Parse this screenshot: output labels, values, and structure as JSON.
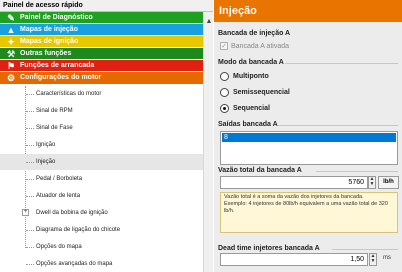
{
  "left_panel": {
    "title": "Painel de acesso rápido",
    "categories": [
      {
        "label": "Painel de Diagnóstico",
        "color": "#20a020",
        "icon": "wrench-icon"
      },
      {
        "label": "Mapas de injeção",
        "color": "#18a0e0",
        "icon": "injector-icon"
      },
      {
        "label": "Mapas de ignição",
        "color": "#e8c800",
        "icon": "spark-icon"
      },
      {
        "label": "Outras funções",
        "color": "#1e8a1e",
        "icon": "tool-icon"
      },
      {
        "label": "Funções de arrancada",
        "color": "#e02010",
        "icon": "flag-icon"
      },
      {
        "label": "Configurações do motor",
        "color": "#e46a00",
        "icon": "engine-icon"
      }
    ],
    "sub_items": [
      "Características do motor",
      "Sinal de RPM",
      "Sinal de Fase",
      "Ignição",
      "Injeção",
      "Pedal / Borboleta",
      "Atuador de lenta",
      "Dwell da bobina de ignição",
      "Diagrama de ligação do chicote",
      "Opções do mapa",
      "Opções avançadas do mapa"
    ],
    "selected_index": 4
  },
  "right_panel": {
    "header": "Injeção",
    "group1_title": "Bancada de injeção A",
    "checkbox_label": "Bancada A ativada",
    "mode_title": "Modo da bancada A",
    "radios": [
      "Multiponto",
      "Semissequencial",
      "Sequencial"
    ],
    "radio_selected": 2,
    "outputs_title": "Saídas bancada A",
    "outputs_item": "8",
    "flow_title": "Vazão total da bancada A",
    "flow_value": "5760",
    "flow_unit": "lb/h",
    "info_text": "Vazão total é a soma da vazão dos injetores da bancada.\n Exemplo: 4 injetores de 80lb/h equivalem a uma vazão total de 320 lb/h.",
    "dead_time_title": "Dead time injetores bancada A",
    "dead_time_value": "1,50",
    "dead_time_unit": "ms"
  }
}
